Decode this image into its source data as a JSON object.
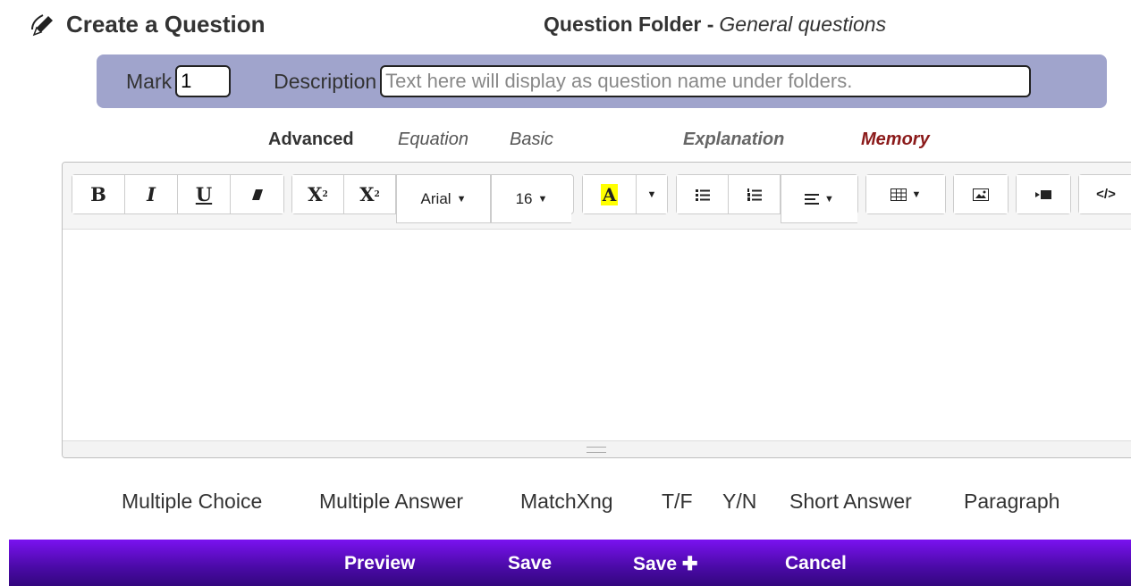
{
  "header": {
    "title": "Create a Question",
    "folder_label": "Question Folder -",
    "folder_name": "General questions"
  },
  "mark_bar": {
    "mark_label": "Mark",
    "mark_value": "1",
    "description_label": "Description",
    "description_placeholder": "Text here will display as question name under folders."
  },
  "modes": {
    "advanced": "Advanced",
    "equation": "Equation",
    "basic": "Basic",
    "explanation": "Explanation",
    "memory": "Memory"
  },
  "toolbar": {
    "bold": "B",
    "italic": "I",
    "underline": "U",
    "superscript": "X",
    "subscript": "X",
    "font_name": "Arial",
    "font_size": "16",
    "color_letter": "A",
    "code": "</>"
  },
  "question_types": [
    "Multiple Choice",
    "Multiple Answer",
    "MatchXng",
    "T/F",
    "Y/N",
    "Short Answer",
    "Paragraph"
  ],
  "actions": {
    "preview": "Preview",
    "save": "Save",
    "save_plus": "Save ✚",
    "cancel": "Cancel"
  },
  "colors": {
    "mark_bar_bg": "#a0a4cc",
    "memory": "#8b1a1a",
    "action_bar": "#5a0bd0",
    "highlight": "#ffff00"
  }
}
